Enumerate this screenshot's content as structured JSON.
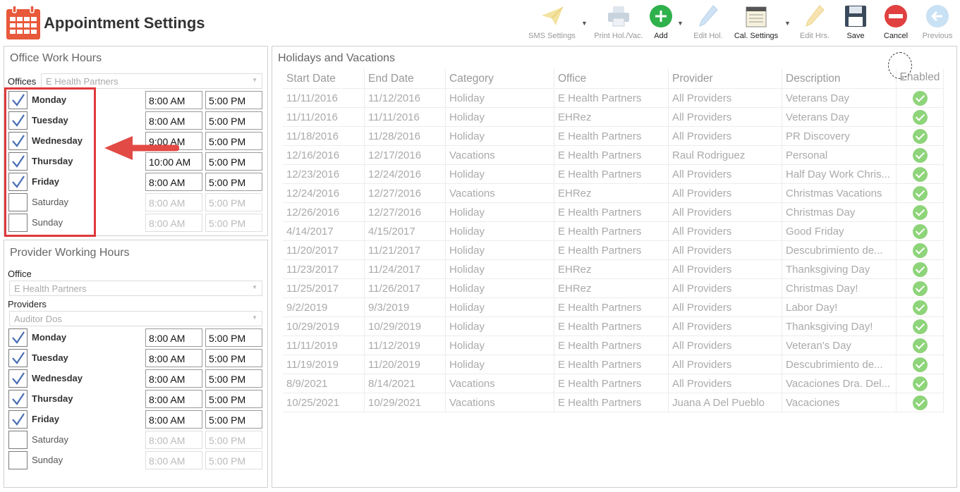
{
  "app": {
    "title": "Appointment Settings"
  },
  "toolbar": {
    "sms_settings": "SMS Settings",
    "print_hol_vac": "Print Hol./Vac.",
    "add": "Add",
    "edit_hol": "Edit Hol.",
    "cal_settings": "Cal. Settings",
    "edit_hrs": "Edit Hrs.",
    "save": "Save",
    "cancel": "Cancel",
    "previous": "Previous"
  },
  "office_hours": {
    "title": "Office Work Hours",
    "offices_label": "Offices",
    "office_value": "E Health Partners",
    "days": [
      {
        "label": "Monday",
        "checked": true,
        "start": "8:00 AM",
        "end": "5:00 PM"
      },
      {
        "label": "Tuesday",
        "checked": true,
        "start": "8:00 AM",
        "end": "5:00 PM"
      },
      {
        "label": "Wednesday",
        "checked": true,
        "start": "9:00 AM",
        "end": "5:00 PM"
      },
      {
        "label": "Thursday",
        "checked": true,
        "start": "10:00 AM",
        "end": "5:00 PM"
      },
      {
        "label": "Friday",
        "checked": true,
        "start": "8:00 AM",
        "end": "5:00 PM"
      },
      {
        "label": "Saturday",
        "checked": false,
        "start": "8:00 AM",
        "end": "5:00 PM"
      },
      {
        "label": "Sunday",
        "checked": false,
        "start": "8:00 AM",
        "end": "5:00 PM"
      }
    ]
  },
  "provider_hours": {
    "title": "Provider Working Hours",
    "office_label": "Office",
    "office_value": "E Health Partners",
    "providers_label": "Providers",
    "provider_value": "Auditor Dos",
    "days": [
      {
        "label": "Monday",
        "checked": true,
        "start": "8:00 AM",
        "end": "5:00 PM"
      },
      {
        "label": "Tuesday",
        "checked": true,
        "start": "8:00 AM",
        "end": "5:00 PM"
      },
      {
        "label": "Wednesday",
        "checked": true,
        "start": "8:00 AM",
        "end": "5:00 PM"
      },
      {
        "label": "Thursday",
        "checked": true,
        "start": "8:00 AM",
        "end": "5:00 PM"
      },
      {
        "label": "Friday",
        "checked": true,
        "start": "8:00 AM",
        "end": "5:00 PM"
      },
      {
        "label": "Saturday",
        "checked": false,
        "start": "8:00 AM",
        "end": "5:00 PM"
      },
      {
        "label": "Sunday",
        "checked": false,
        "start": "8:00 AM",
        "end": "5:00 PM"
      }
    ]
  },
  "holidays": {
    "title": "Holidays and Vacations",
    "columns": [
      "Start Date",
      "End Date",
      "Category",
      "Office",
      "Provider",
      "Description",
      "Enabled"
    ],
    "rows": [
      [
        "11/11/2016",
        "11/12/2016",
        "Holiday",
        "E Health Partners",
        "All Providers",
        "Veterans Day"
      ],
      [
        "11/11/2016",
        "11/11/2016",
        "Holiday",
        "EHRez",
        "All Providers",
        "Veterans Day"
      ],
      [
        "11/18/2016",
        "11/28/2016",
        "Holiday",
        "E Health Partners",
        "All Providers",
        "PR Discovery"
      ],
      [
        "12/16/2016",
        "12/17/2016",
        "Vacations",
        "E Health Partners",
        "Raul Rodriguez",
        "Personal"
      ],
      [
        "12/23/2016",
        "12/24/2016",
        "Holiday",
        "E Health Partners",
        "All Providers",
        "Half Day Work Chris..."
      ],
      [
        "12/24/2016",
        "12/27/2016",
        "Vacations",
        "EHRez",
        "All Providers",
        "Christmas Vacations"
      ],
      [
        "12/26/2016",
        "12/27/2016",
        "Holiday",
        "E Health Partners",
        "All Providers",
        "Christmas Day"
      ],
      [
        "4/14/2017",
        "4/15/2017",
        "Holiday",
        "E Health Partners",
        "All Providers",
        "Good Friday"
      ],
      [
        "11/20/2017",
        "11/21/2017",
        "Holiday",
        "E Health Partners",
        "All Providers",
        "Descubrimiento de..."
      ],
      [
        "11/23/2017",
        "11/24/2017",
        "Holiday",
        "EHRez",
        "All Providers",
        "Thanksgiving Day"
      ],
      [
        "11/25/2017",
        "11/26/2017",
        "Holiday",
        "EHRez",
        "All Providers",
        "Christmas Day!"
      ],
      [
        "9/2/2019",
        "9/3/2019",
        "Holiday",
        "E Health Partners",
        "All Providers",
        "Labor Day!"
      ],
      [
        "10/29/2019",
        "10/29/2019",
        "Holiday",
        "E Health Partners",
        "All Providers",
        "Thanksgiving Day!"
      ],
      [
        "11/11/2019",
        "11/12/2019",
        "Holiday",
        "E Health Partners",
        "All Providers",
        "Veteran's Day"
      ],
      [
        "11/19/2019",
        "11/20/2019",
        "Holiday",
        "E Health Partners",
        "All Providers",
        "Descubrimiento de..."
      ],
      [
        "8/9/2021",
        "8/14/2021",
        "Vacations",
        "E Health Partners",
        "All Providers",
        "Vacaciones Dra. Del..."
      ],
      [
        "10/25/2021",
        "10/29/2021",
        "Vacations",
        "E Health Partners",
        "Juana A Del Pueblo",
        "Vacaciones"
      ]
    ]
  },
  "colors": {
    "accent_red": "#e0383a",
    "enabled_green": "#8ed47a",
    "add_green": "#2fb14c",
    "check_blue": "#4a6fb5"
  }
}
